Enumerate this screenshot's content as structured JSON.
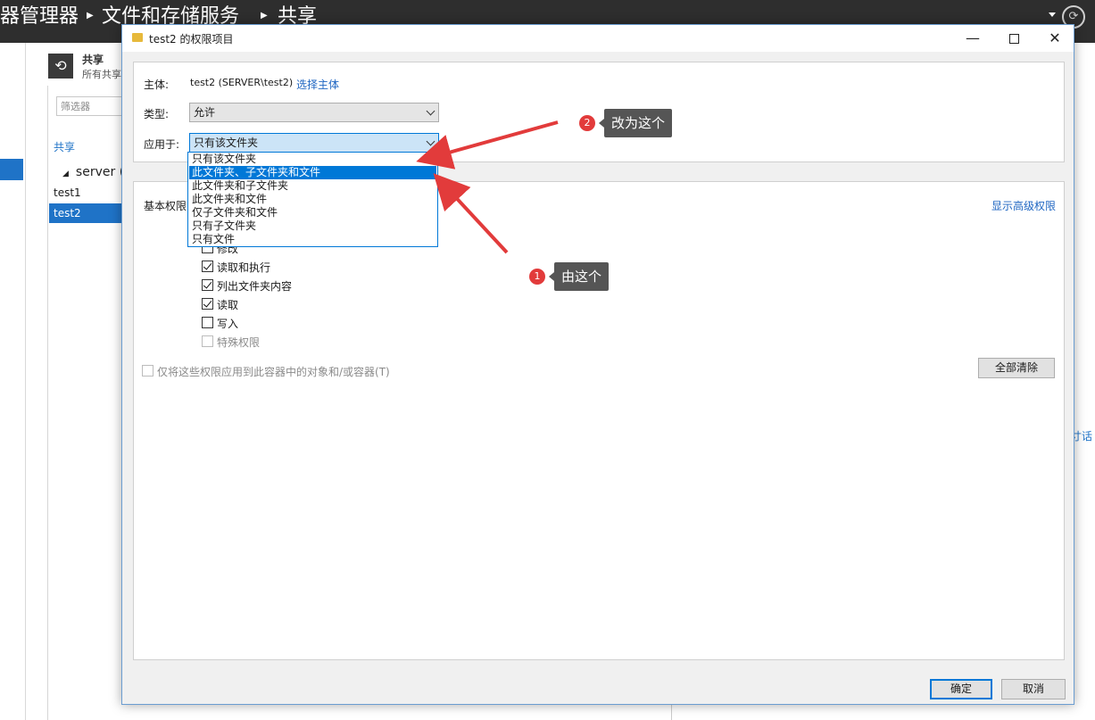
{
  "background": {
    "breadcrumb": [
      "器管理器",
      "文件和存储服务",
      "共享"
    ],
    "tile_title": "共享",
    "tile_subtitle": "所有共享",
    "filter_placeholder": "筛选器",
    "shares_heading": "共享",
    "server_group": "server (",
    "rows": [
      "test1",
      "test2"
    ],
    "right_link_fragment": "寸话"
  },
  "dialog": {
    "title": "test2 的权限项目",
    "principal_label": "主体:",
    "principal_value": "test2 (SERVER\\test2)",
    "select_principal_link": "选择主体",
    "type_label": "类型:",
    "type_value": "允许",
    "applies_label": "应用于:",
    "applies_value": "只有该文件夹",
    "applies_options": [
      "只有该文件夹",
      "此文件夹、子文件夹和文件",
      "此文件夹和子文件夹",
      "此文件夹和文件",
      "仅子文件夹和文件",
      "只有子文件夹",
      "只有文件"
    ],
    "applies_selected_index": 1,
    "basic_permissions_label": "基本权限",
    "show_advanced_link": "显示高级权限",
    "permissions": [
      {
        "label": "修改",
        "checked": false,
        "disabled": false
      },
      {
        "label": "读取和执行",
        "checked": true,
        "disabled": false
      },
      {
        "label": "列出文件夹内容",
        "checked": true,
        "disabled": false
      },
      {
        "label": "读取",
        "checked": true,
        "disabled": false
      },
      {
        "label": "写入",
        "checked": false,
        "disabled": false
      },
      {
        "label": "特殊权限",
        "checked": false,
        "disabled": true
      }
    ],
    "apply_only_label": "仅将这些权限应用到此容器中的对象和/或容器(T)",
    "clear_all_button": "全部清除",
    "ok_button": "确定",
    "cancel_button": "取消"
  },
  "annotations": [
    {
      "number": "1",
      "text": "由这个"
    },
    {
      "number": "2",
      "text": "改为这个"
    }
  ],
  "colors": {
    "accent": "#0078d7",
    "link": "#1f66c2",
    "annotation_red": "#e23b3b",
    "callout_bg": "#555555",
    "topbar_bg": "#2e2e2e"
  }
}
